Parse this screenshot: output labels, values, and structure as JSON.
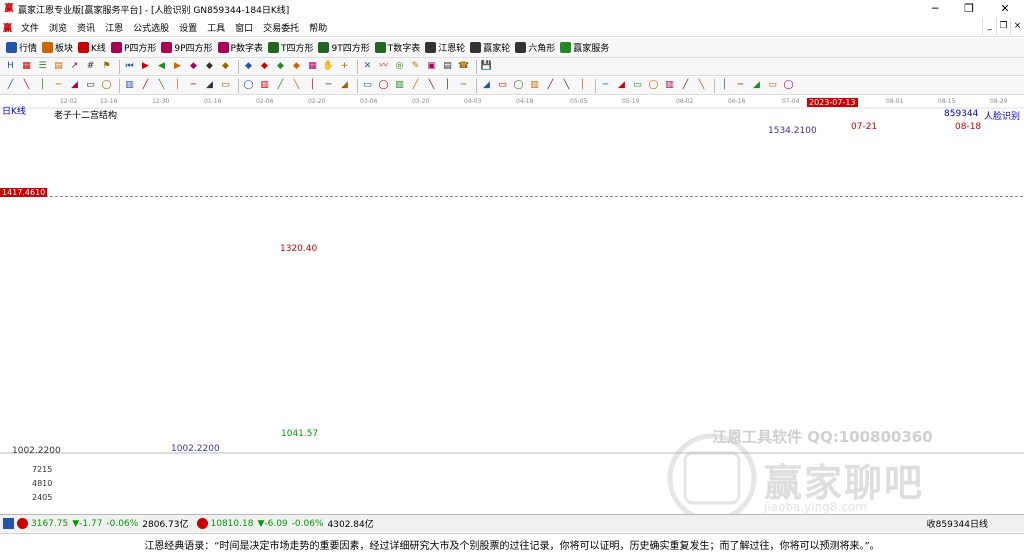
{
  "window": {
    "title": "赢家江恩专业版[赢家服务平台] - [人脸识别  GN859344-184日K线]",
    "buttons": [
      "─",
      "❐",
      "✕"
    ]
  },
  "menu": {
    "items": [
      "文件",
      "浏览",
      "资讯",
      "江恩",
      "公式选股",
      "设置",
      "工具",
      "窗口",
      "交易委托",
      "帮助"
    ],
    "mdi_buttons": [
      "_",
      "❐",
      "×"
    ]
  },
  "toolbar1": {
    "items": [
      {
        "label": "行情",
        "icon": "grid-icon",
        "color": "#2255aa"
      },
      {
        "label": "板块",
        "icon": "blocks-icon",
        "color": "#cc6600"
      },
      {
        "label": "K线",
        "icon": "kline-icon",
        "color": "#cc0000"
      },
      {
        "label": "P四方形",
        "icon": "square-p-icon",
        "color": "#aa0055"
      },
      {
        "label": "9P四方形",
        "icon": "square-9p-icon",
        "color": "#aa0055"
      },
      {
        "label": "P数字表",
        "icon": "table-p-icon",
        "color": "#aa0055"
      },
      {
        "label": "T四方形",
        "icon": "square-t-icon",
        "color": "#226622"
      },
      {
        "label": "9T四方形",
        "icon": "square-9t-icon",
        "color": "#226622"
      },
      {
        "label": "T数字表",
        "icon": "table-t-icon",
        "color": "#226622"
      },
      {
        "label": "江恩轮",
        "icon": "wheel-icon",
        "color": "#333333"
      },
      {
        "label": "赢家轮",
        "icon": "wheel2-icon",
        "color": "#333333"
      },
      {
        "label": "六角形",
        "icon": "hexagon-icon",
        "color": "#333333"
      },
      {
        "label": "赢家服务",
        "icon": "dollar-icon",
        "color": "#228822"
      }
    ]
  },
  "toolbar2": {
    "icons": [
      "h-icon",
      "grid2-icon",
      "list-icon",
      "chart-icon",
      "arrow-icon",
      "number-icon",
      "flag-icon",
      "first-icon",
      "play-icon",
      "prev-icon",
      "next-icon",
      "diamond1-icon",
      "diamond2-icon",
      "diamond3-icon",
      "diamond4-icon",
      "diamond5-icon",
      "diamond6-icon",
      "diamond7-icon",
      "grid3-icon",
      "hand-icon",
      "plus-icon",
      "cross-icon",
      "wave-icon",
      "target-icon",
      "memo-icon",
      "calc-icon",
      "book-icon",
      "phone-icon",
      "save-icon"
    ]
  },
  "toolbar3": {
    "icons": [
      "pencil-icon",
      "line1-icon",
      "line2-icon",
      "line3-icon",
      "line4-icon",
      "line5-icon",
      "line6-icon",
      "line7-icon",
      "line8-icon",
      "circle-icon",
      "ellipse-icon",
      "rect1-icon",
      "rect2-icon",
      "rect3-icon",
      "rect4-icon",
      "rect5-icon",
      "rect6-icon",
      "rect7-icon",
      "rect8-icon",
      "rect9-icon",
      "bar1-icon",
      "bar2-icon",
      "bar3-icon",
      "bar4-icon",
      "bar5-icon",
      "bar6-icon",
      "bar7-icon",
      "scale-icon",
      "slash-icon",
      "percent-icon",
      "fan-icon",
      "fib-icon",
      "gann-icon",
      "angle1-icon",
      "angle2-icon",
      "angle3-icon",
      "angle4-icon",
      "box1-icon",
      "box2-icon",
      "box3-icon",
      "box4-icon",
      "box5-icon",
      "box6-icon",
      "box7-icon",
      "box8-icon",
      "color-icon",
      "link-icon"
    ]
  },
  "chart": {
    "period_label": "日K线",
    "indicator_name": "老子十二宫结构",
    "code_label": "859344",
    "name_label": "人脸识别",
    "price_tag": "1417.4610",
    "current_date_tag": "2023-07-13",
    "date_marks": [
      "07-21",
      "08-18"
    ],
    "high_label": "1534.2100",
    "low_label": "1002.2200",
    "box_high": "1320.40",
    "box_low": "1041.57",
    "axis_left_low": "1002.2200",
    "volume_ticks": [
      "7215",
      "4810",
      "2405"
    ],
    "watermark_text": "江恩工具软件  QQ:100800360",
    "watermark_brand": "赢家聊吧",
    "watermark_url": "jiaoba.ying8.com",
    "date_axis": [
      "12-02",
      "12-16",
      "12-30",
      "01-16",
      "02-06",
      "02-20",
      "03-06",
      "03-20",
      "04-03",
      "04-18",
      "05-05",
      "05-19",
      "06-02",
      "06-16",
      "07-04",
      "08-01",
      "08-15",
      "08-29"
    ],
    "colors": {
      "up": "#cc0000",
      "down": "#009900",
      "box": "#cc0000",
      "tag_bg": "#cc0000",
      "blue_line": "#3333aa"
    }
  },
  "chart_data": {
    "type": "candlestick",
    "title": "",
    "ylabel": "",
    "ylim": [
      1002.22,
      1534.21
    ],
    "values": [],
    "annotations": [
      {
        "label": "1534.2100",
        "kind": "high"
      },
      {
        "label": "1002.2200",
        "kind": "low"
      },
      {
        "label": "1320.40",
        "kind": "box-high"
      },
      {
        "label": "1041.57",
        "kind": "box-low"
      },
      {
        "label": "1417.4610",
        "kind": "price-line"
      }
    ]
  },
  "statusbar": {
    "idx1_value": "3167.75",
    "idx1_change": "▼-1.77",
    "idx1_pct": "-0.06%",
    "idx1_amount": "2806.73亿",
    "idx2_value": "10810.18",
    "idx2_change": "▼-6.09",
    "idx2_pct": "-0.06%",
    "idx2_amount": "4302.84亿",
    "right_text": "收859344日线"
  },
  "quote": {
    "text": "江恩经典语录：“时间是决定市场走势的重要因素，经过详细研究大市及个别股票的过往记录，你将可以证明，历史确实重复发生；而了解过往，你将可以预测将来。”。"
  }
}
